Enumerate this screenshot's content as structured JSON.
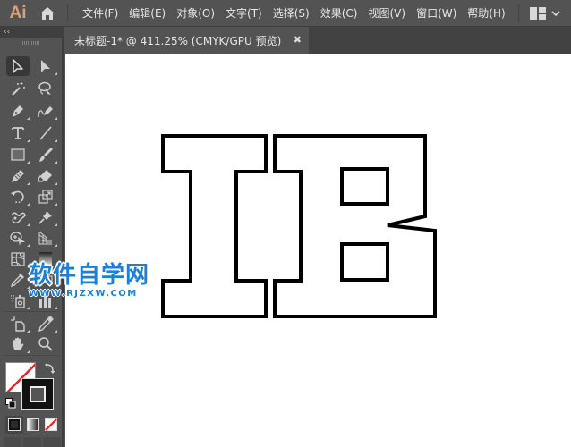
{
  "app": {
    "logo": "Ai",
    "accent_color": "#d9a07a"
  },
  "menubar": {
    "items": [
      {
        "label": "文件(F)"
      },
      {
        "label": "编辑(E)"
      },
      {
        "label": "对象(O)"
      },
      {
        "label": "文字(T)"
      },
      {
        "label": "选择(S)"
      },
      {
        "label": "效果(C)"
      },
      {
        "label": "视图(V)"
      },
      {
        "label": "窗口(W)"
      },
      {
        "label": "帮助(H)"
      }
    ],
    "workspace_icon": "workspace-layout-icon",
    "workspace_chevron": "chevron-down-icon"
  },
  "tools_panel": {
    "collapse_glyph": "‹‹",
    "tools": [
      {
        "name": "selection-tool",
        "icon": "arrow-outline-icon",
        "active": true
      },
      {
        "name": "direct-selection-tool",
        "icon": "arrow-solid-icon"
      },
      {
        "name": "magic-wand-tool",
        "icon": "magic-wand-icon"
      },
      {
        "name": "lasso-tool",
        "icon": "lasso-icon"
      },
      {
        "name": "pen-tool",
        "icon": "pen-icon"
      },
      {
        "name": "curvature-tool",
        "icon": "curvature-pen-icon"
      },
      {
        "name": "type-tool",
        "icon": "type-icon"
      },
      {
        "name": "line-segment-tool",
        "icon": "line-icon"
      },
      {
        "name": "rectangle-tool",
        "icon": "rectangle-icon"
      },
      {
        "name": "paintbrush-tool",
        "icon": "paintbrush-icon"
      },
      {
        "name": "shaper-tool",
        "icon": "pencil-icon"
      },
      {
        "name": "eraser-tool",
        "icon": "eraser-icon"
      },
      {
        "name": "rotate-tool",
        "icon": "rotate-icon"
      },
      {
        "name": "scale-tool",
        "icon": "scale-icon"
      },
      {
        "name": "warp-tool",
        "icon": "warp-icon"
      },
      {
        "name": "puppet-warp-tool",
        "icon": "pin-icon"
      },
      {
        "name": "shape-builder-tool",
        "icon": "shape-builder-icon"
      },
      {
        "name": "perspective-grid-tool",
        "icon": "perspective-grid-icon"
      },
      {
        "name": "mesh-tool",
        "icon": "mesh-icon"
      },
      {
        "name": "gradient-tool",
        "icon": "gradient-icon"
      },
      {
        "name": "eyedropper-tool",
        "icon": "eyedropper-icon"
      },
      {
        "name": "blend-tool",
        "icon": "blend-icon"
      },
      {
        "name": "symbol-sprayer-tool",
        "icon": "symbol-sprayer-icon"
      },
      {
        "name": "column-graph-tool",
        "icon": "column-graph-icon"
      },
      {
        "name": "artboard-tool",
        "icon": "artboard-icon"
      },
      {
        "name": "slice-tool",
        "icon": "slice-icon"
      },
      {
        "name": "hand-tool",
        "icon": "hand-icon"
      },
      {
        "name": "zoom-tool",
        "icon": "magnifier-icon"
      }
    ],
    "fill": {
      "color": "none"
    },
    "stroke": {
      "color": "#000000"
    },
    "modes": [
      "color-mode",
      "gradient-mode",
      "none-mode"
    ]
  },
  "document": {
    "tab_title": "未标题-1* @ 411.25% (CMYK/GPU 预览)",
    "close_glyph": "✖",
    "zoom": "411.25%",
    "color_mode": "CMYK/GPU 预览"
  },
  "artwork": {
    "text": "IB",
    "style": "outlined",
    "stroke_color": "#000000",
    "fill_color": "#ffffff"
  },
  "watermark": {
    "title": "软件自学网",
    "url": "WWW.RJZXW.COM",
    "color": "#1a7fd6"
  }
}
